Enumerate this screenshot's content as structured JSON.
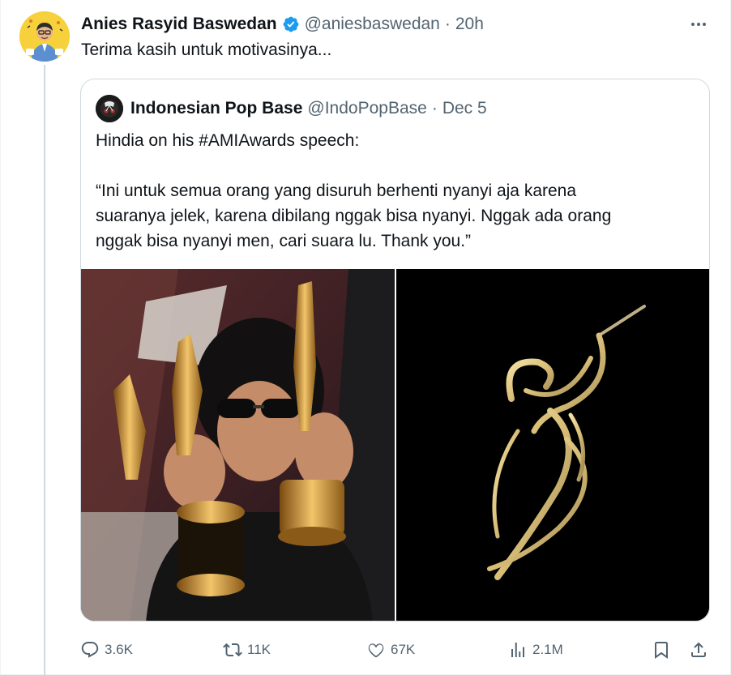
{
  "tweet": {
    "author_name": "Anies Rasyid Baswedan",
    "handle": "@aniesbaswedan",
    "separator": "·",
    "time": "20h",
    "text": "Terima kasih untuk motivasinya...",
    "avatar_icon": "person-avatar",
    "verified_icon": "verified-badge-icon",
    "more_icon": "more-dots-icon"
  },
  "quote": {
    "author_name": "Indonesian Pop Base",
    "handle": "@IndoPopBase",
    "separator": "·",
    "date": "Dec 5",
    "lines": [
      "Hindia on his #AMIAwards speech:",
      "“Ini untuk semua orang yang disuruh berhenti nyanyi aja karena",
      "suaranya jelek, karena dibilang nggak bisa nyanyi. Nggak ada orang",
      "nggak bisa nyanyi men, cari suara lu. Thank you.”"
    ],
    "media": [
      {
        "icon": "photo-singer-with-trophies"
      },
      {
        "icon": "photo-ami-awards-logo"
      }
    ]
  },
  "actions": {
    "reply_count": "3.6K",
    "retweet_count": "11K",
    "like_count": "67K",
    "views_count": "2.1M"
  },
  "colors": {
    "text": "#0f1419",
    "muted": "#536471",
    "border": "#cfd9de",
    "verified": "#1d9bf0",
    "avatar_bg": "#f6d13c"
  }
}
